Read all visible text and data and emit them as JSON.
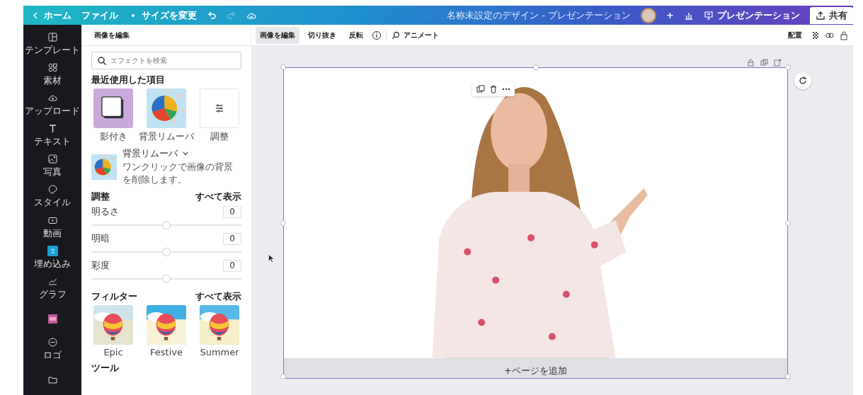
{
  "topbar": {
    "home": "ホーム",
    "file": "ファイル",
    "resize": "サイズを変更",
    "undo": {
      "disabled": false
    },
    "redo": {
      "disabled": true
    },
    "title": "名称未設定のデザイン - プレゼンテーション",
    "add": "+",
    "present": "プレゼンテーション",
    "share": "共有"
  },
  "sidebar": {
    "items": [
      {
        "label": "テンプレート",
        "selected": false
      },
      {
        "label": "素材",
        "selected": false
      },
      {
        "label": "アップロード",
        "selected": false
      },
      {
        "label": "テキスト",
        "selected": false
      },
      {
        "label": "写真",
        "selected": false
      },
      {
        "label": "スタイル",
        "selected": false
      },
      {
        "label": "動画",
        "selected": false
      },
      {
        "label": "埋め込み",
        "selected": true
      },
      {
        "label": "グラフ",
        "selected": false
      },
      {
        "selected": false
      },
      {
        "label": "ロゴ",
        "selected": false
      },
      {
        "selected": false
      }
    ]
  },
  "toolbar": {
    "title": "画像を編集",
    "tabs": [
      {
        "label": "画像を編集",
        "selected": true
      },
      {
        "label": "切り抜き",
        "selected": false
      },
      {
        "label": "反転",
        "selected": false
      }
    ],
    "animate": "アニメート",
    "arrange": "配置"
  },
  "panel": {
    "search": {
      "placeholder": "エフェクトを検索"
    },
    "recent": {
      "heading": "最近使用した項目",
      "items": [
        {
          "label": "影付き",
          "kind": "shadow"
        },
        {
          "label": "背景リムーバ",
          "kind": "remover"
        },
        {
          "label": "調整",
          "kind": "adjust"
        }
      ]
    },
    "remover": {
      "title": "背景リムーバ",
      "description": "ワンクリックで画像の背景を削除します。"
    },
    "adjust": {
      "heading": "調整",
      "show_all": "すべて表示",
      "sliders": [
        {
          "label": "明るさ",
          "value": "0",
          "level": 0.5
        },
        {
          "label": "明暗",
          "value": "0",
          "level": 0.5
        },
        {
          "label": "彩度",
          "value": "0",
          "level": 0.5
        }
      ]
    },
    "filters": {
      "heading": "フィルター",
      "show_all": "すべて表示",
      "items": [
        {
          "label": "Epic"
        },
        {
          "label": "Festive"
        },
        {
          "label": "Summer"
        }
      ]
    },
    "tools_heading": "ツール"
  },
  "canvas": {
    "add_page": "+ページを追加"
  }
}
